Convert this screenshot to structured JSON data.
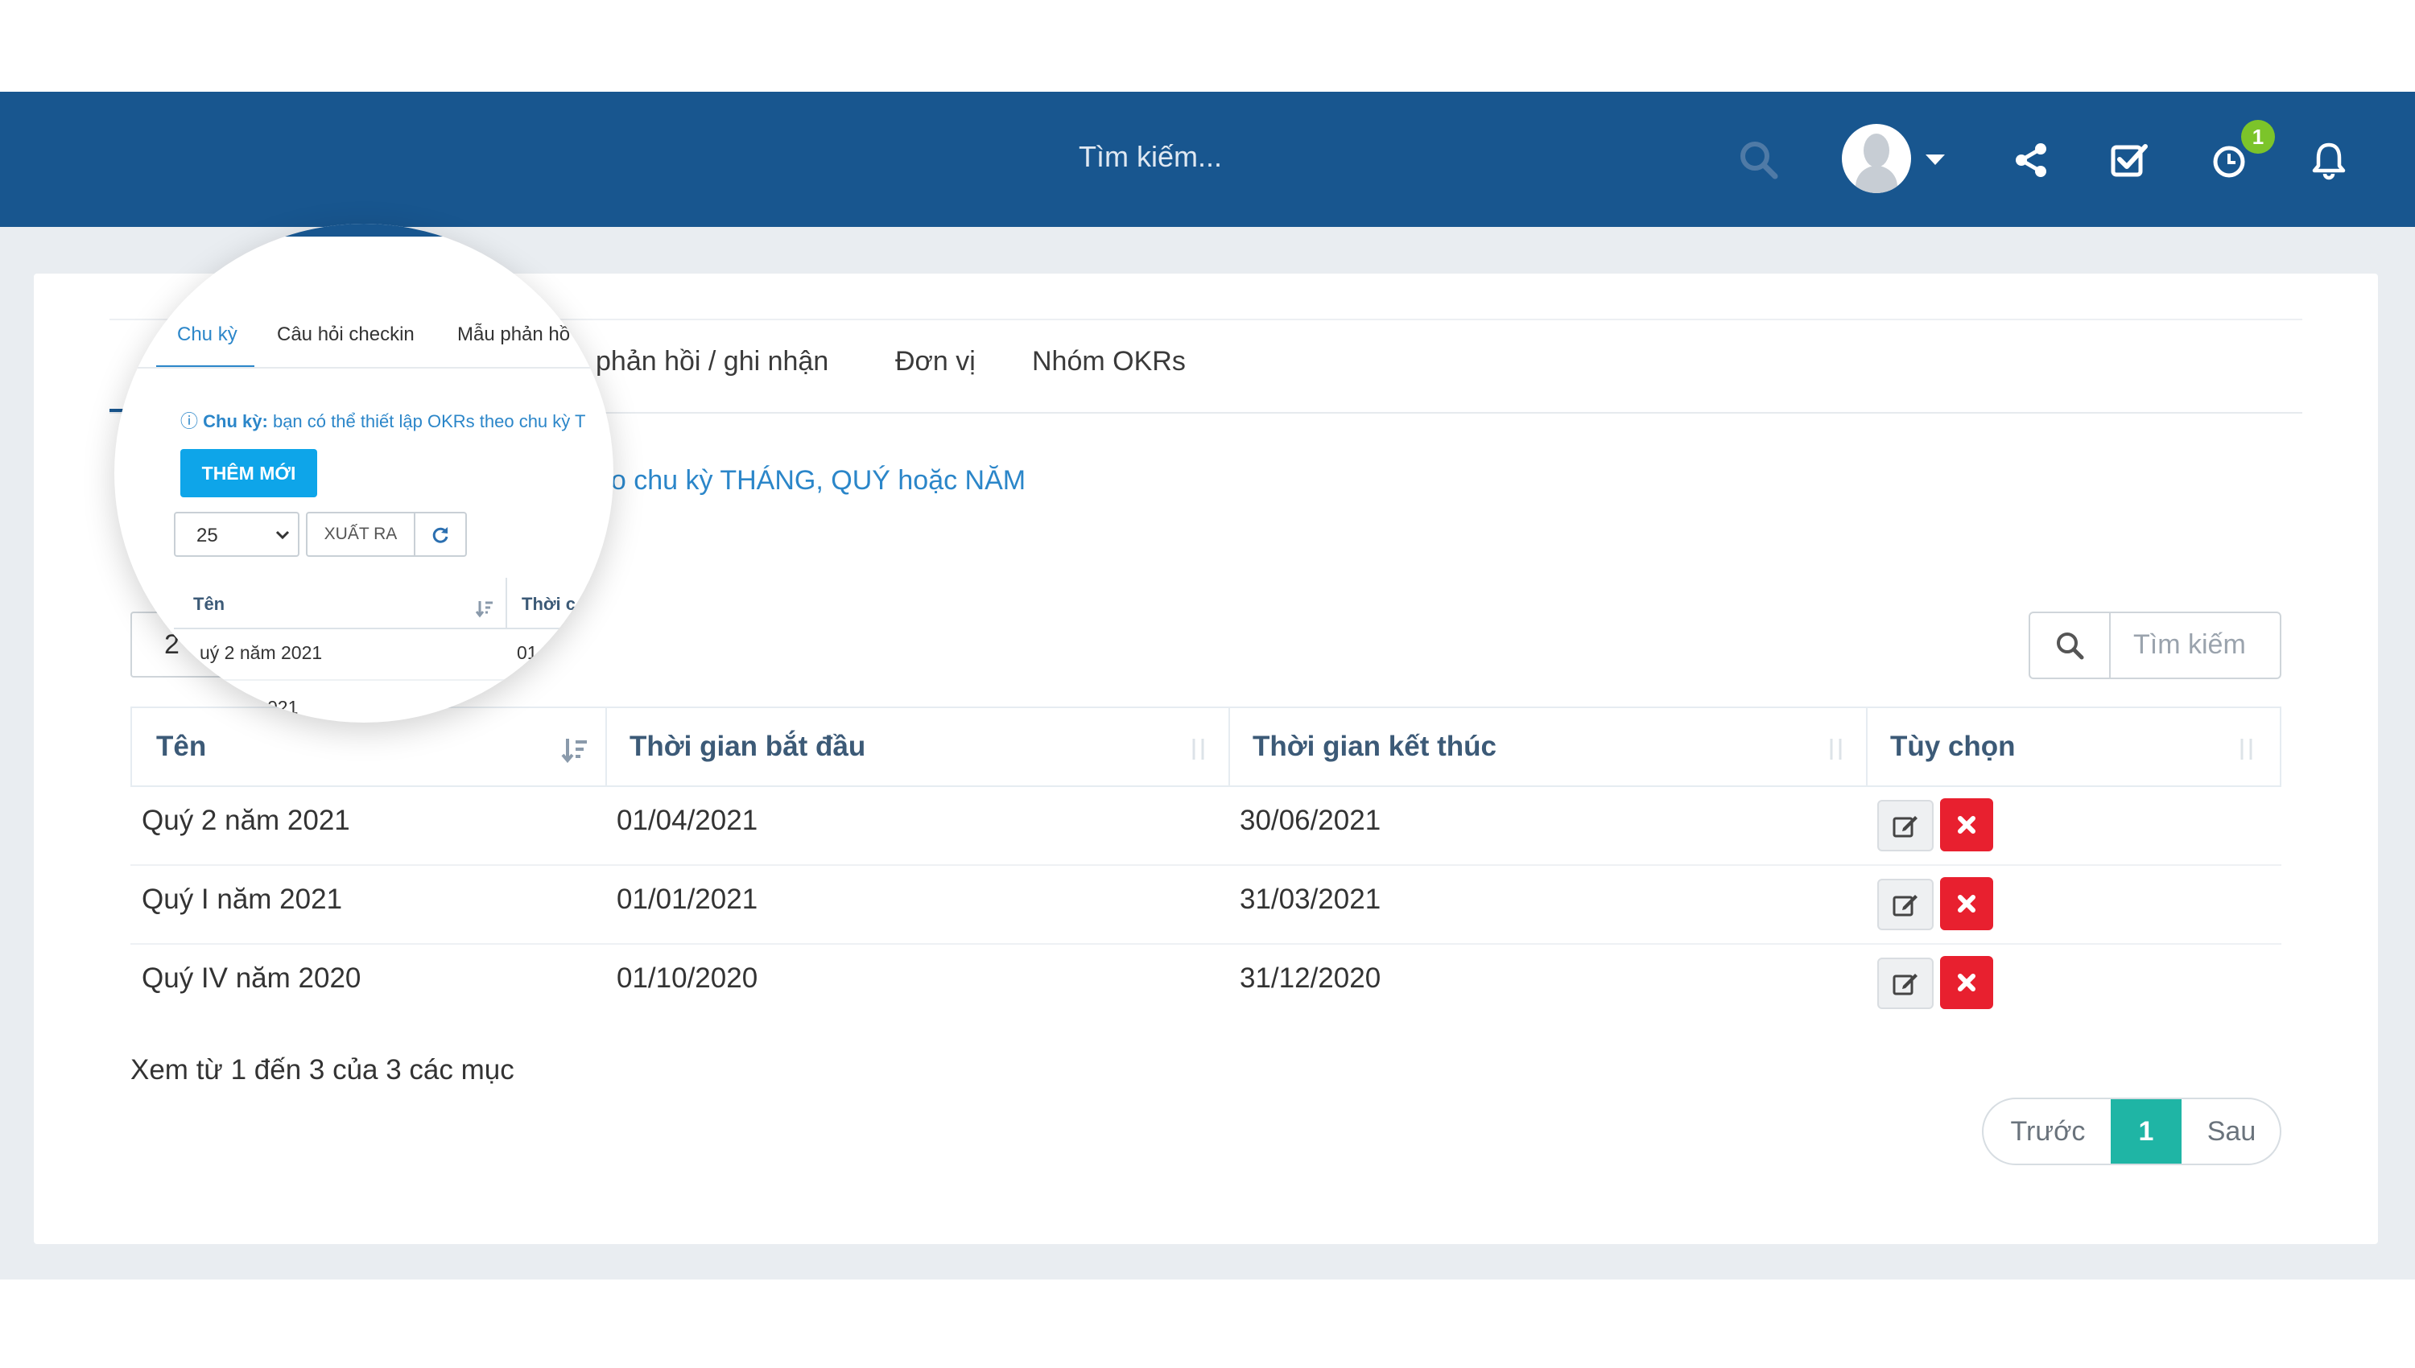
{
  "navbar": {
    "search_placeholder": "Tìm kiếm...",
    "notification_count": "1",
    "colors": {
      "bar": "#18568f",
      "badge": "#7cc42a"
    }
  },
  "tabs": [
    {
      "label": "Chu kỳ"
    },
    {
      "label": "Câu hỏi checkin"
    },
    {
      "label": "Mẫu phản hồi / ghi nhận"
    },
    {
      "label": "Đơn vị"
    },
    {
      "label": "Nhóm OKRs"
    }
  ],
  "visible_tabs": {
    "feedback": "phản hồi / ghi nhận",
    "unit": "Đơn vị",
    "okr_group": "Nhóm OKRs"
  },
  "info": {
    "visible_text": "eo chu kỳ THÁNG, QUÝ hoặc NĂM"
  },
  "page_size_fragment": "2",
  "search": {
    "placeholder": "Tìm kiếm"
  },
  "table": {
    "columns": [
      "Tên",
      "Thời gian bắt đầu",
      "Thời gian kết thúc",
      "Tùy chọn"
    ],
    "rows": [
      {
        "name": "Quý 2 năm 2021",
        "start": "01/04/2021",
        "end": "30/06/2021"
      },
      {
        "name": "Quý I năm 2021",
        "start": "01/01/2021",
        "end": "31/03/2021"
      },
      {
        "name": "Quý IV năm 2020",
        "start": "01/10/2020",
        "end": "31/12/2020"
      }
    ]
  },
  "summary": "Xem từ 1 đến 3 của 3 các mục",
  "pagination": {
    "prev": "Trước",
    "current": "1",
    "next": "Sau"
  },
  "magnifier": {
    "tabs": [
      "Chu kỳ",
      "Câu hỏi checkin",
      "Mẫu phản hồ"
    ],
    "info_label": "Chu kỳ:",
    "info_text": "bạn có thể thiết lập OKRs theo chu kỳ T",
    "add_button": "THÊM MỚI",
    "page_size": "25",
    "export_button": "XUẤT RA",
    "col_name": "Tên",
    "col_start_fragment": "Thời c",
    "row1_name": "uý 2 năm 2021",
    "row1_start_fragment": "01",
    "row2_fragment": "021"
  }
}
